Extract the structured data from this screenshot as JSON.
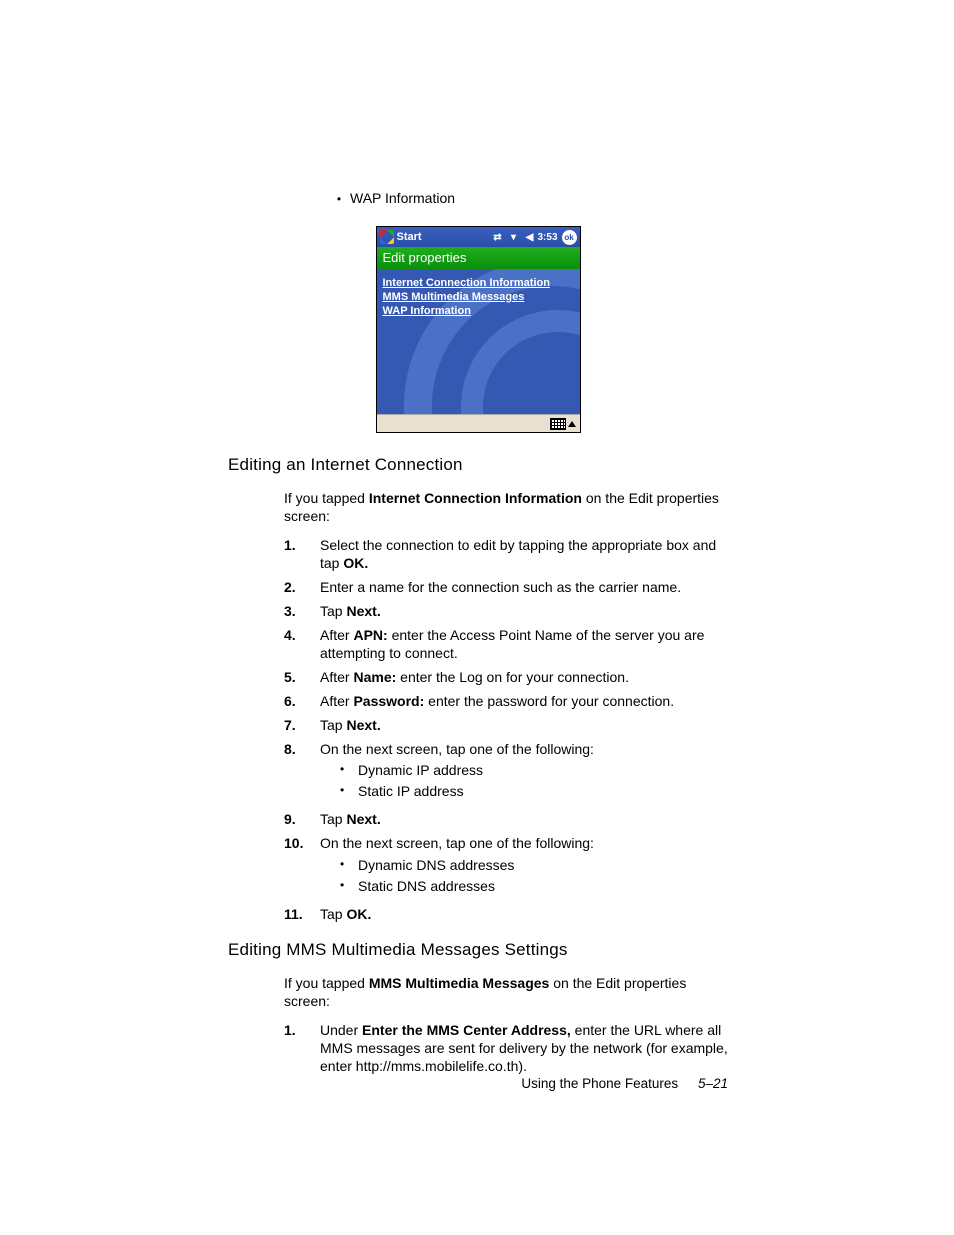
{
  "top_bullet": "WAP Information",
  "phone": {
    "start": "Start",
    "time": "3:53",
    "ok": "ok",
    "header": "Edit properties",
    "links": [
      "Internet Connection Information",
      "MMS Multimedia Messages",
      "WAP Information"
    ]
  },
  "section1": {
    "title": "Editing an Internet Connection",
    "intro_pre": "If you tapped ",
    "intro_bold": "Internet Connection Information",
    "intro_post": " on the Edit properties screen:",
    "steps": [
      {
        "n": "1.",
        "pre": "Select the connection to edit by tapping the appropriate box and tap ",
        "b": "OK.",
        "post": ""
      },
      {
        "n": "2.",
        "pre": "Enter a name for the connection such as the carrier name.",
        "b": "",
        "post": ""
      },
      {
        "n": "3.",
        "pre": "Tap ",
        "b": "Next.",
        "post": ""
      },
      {
        "n": "4.",
        "pre": "After ",
        "b": "APN:",
        "post": " enter the Access Point Name of the server you are attempting to connect."
      },
      {
        "n": "5.",
        "pre": "After ",
        "b": "Name:",
        "post": " enter the Log on for your connection."
      },
      {
        "n": "6.",
        "pre": "After ",
        "b": "Password:",
        "post": " enter the password for your connection."
      },
      {
        "n": "7.",
        "pre": "Tap ",
        "b": "Next.",
        "post": ""
      },
      {
        "n": "8.",
        "pre": "On the next screen, tap one of the following:",
        "b": "",
        "post": "",
        "subs": [
          "Dynamic IP address",
          "Static IP address"
        ]
      },
      {
        "n": "9.",
        "pre": "Tap ",
        "b": "Next.",
        "post": ""
      },
      {
        "n": "10.",
        "pre": "On the next screen, tap one of the following:",
        "b": "",
        "post": "",
        "subs": [
          "Dynamic DNS addresses",
          "Static DNS addresses"
        ]
      },
      {
        "n": "11.",
        "pre": "Tap ",
        "b": "OK.",
        "post": ""
      }
    ]
  },
  "section2": {
    "title": "Editing MMS Multimedia Messages Settings",
    "intro_pre": "If you tapped ",
    "intro_bold": "MMS Multimedia Messages",
    "intro_post": " on the Edit properties screen:",
    "steps": [
      {
        "n": "1.",
        "pre": "Under ",
        "b": "Enter the MMS Center Address,",
        "post": " enter the URL where all MMS messages are sent for delivery by the network (for example, enter http://mms.mobilelife.co.th)."
      }
    ]
  },
  "footer": {
    "chapter": "Using the Phone Features",
    "page": "5–21"
  }
}
